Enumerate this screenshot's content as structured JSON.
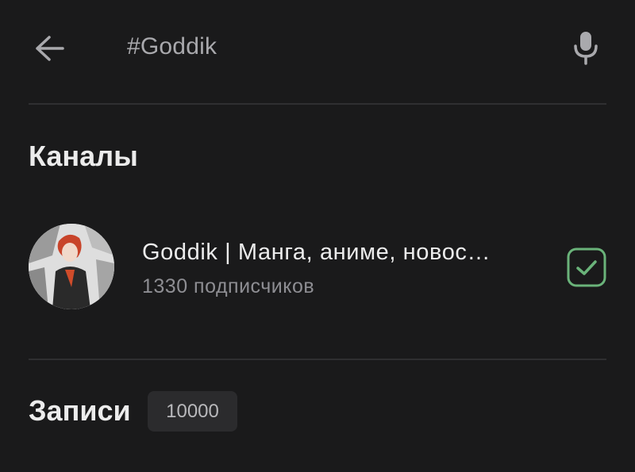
{
  "search": {
    "query": "#Goddik",
    "back_icon": "arrow-left-icon",
    "mic_icon": "microphone-icon"
  },
  "sections": {
    "channels_title": "Каналы",
    "posts_title": "Записи",
    "posts_count": "10000"
  },
  "channels": [
    {
      "name": "Goddik | Манга, аниме, новос…",
      "subscribers": "1330 подписчиков",
      "selected": true,
      "check_icon": "checkbox-checked-icon"
    }
  ],
  "colors": {
    "background": "#1a1a1b",
    "accent_green": "#6ab37a",
    "text_primary": "#ececec",
    "text_secondary": "#8e8e93"
  }
}
